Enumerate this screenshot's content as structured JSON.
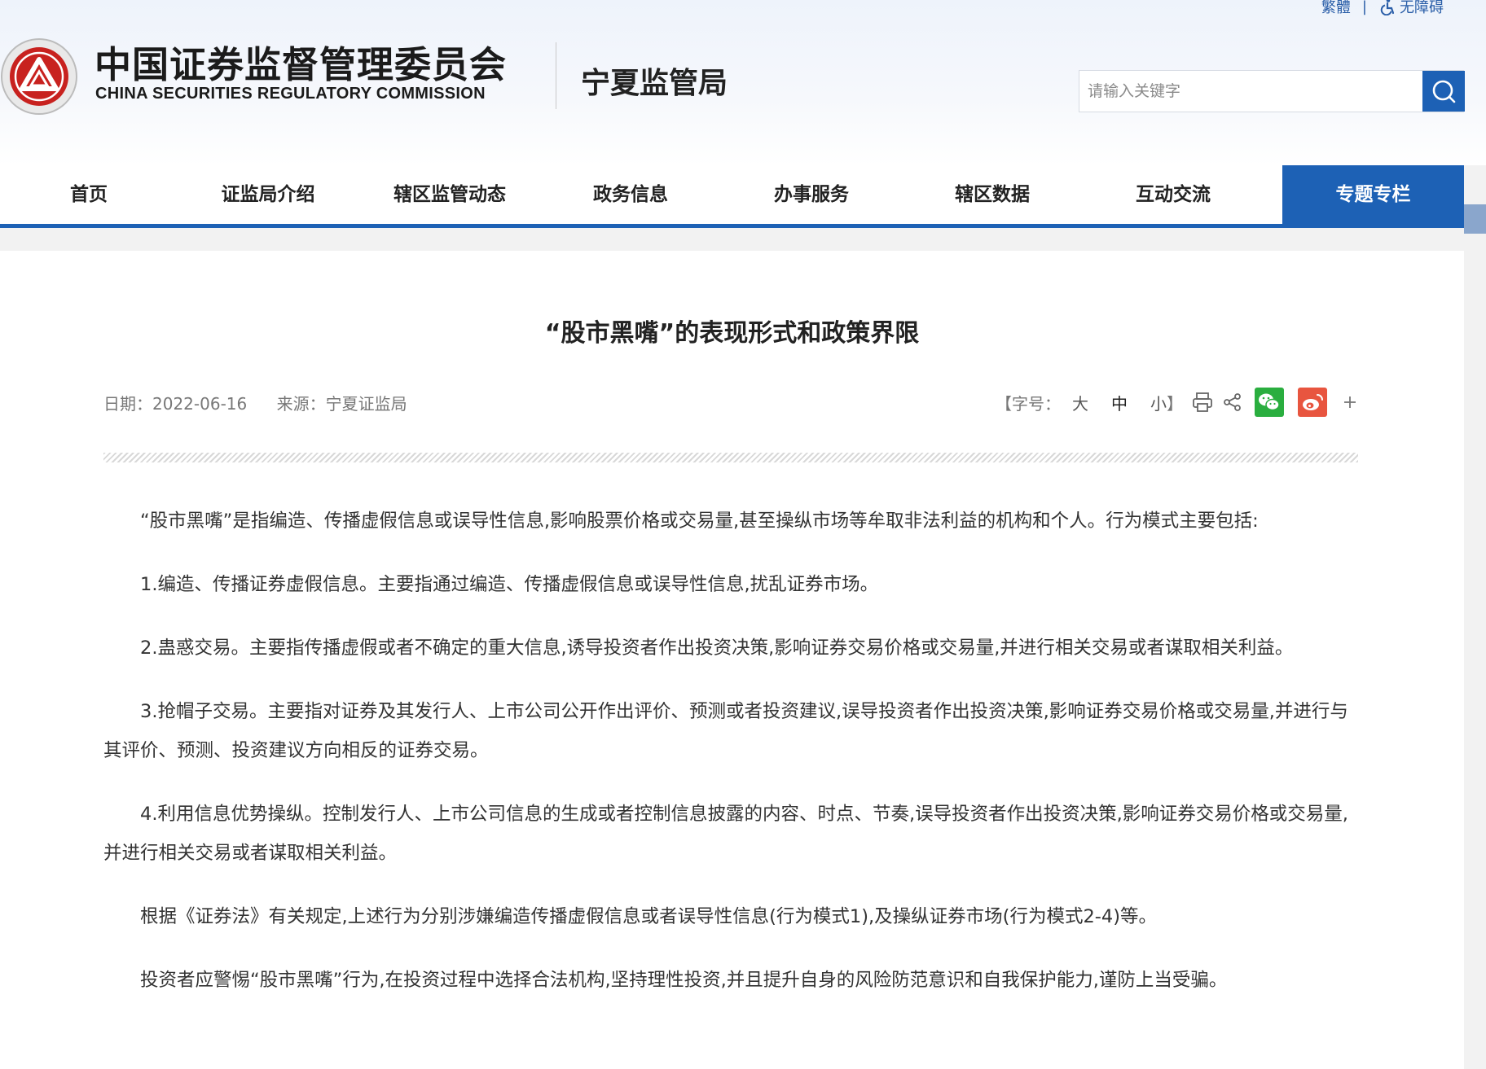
{
  "header": {
    "top_links": {
      "traditional": "繁體",
      "separator": "|",
      "accessibility": "无障碍"
    },
    "org_name_cn": "中国证券监督管理委员会",
    "org_name_en": "CHINA SECURITIES REGULATORY COMMISSION",
    "bureau_name": "宁夏监管局",
    "search": {
      "placeholder": "请输入关键字",
      "value": ""
    }
  },
  "nav": {
    "items": [
      {
        "label": "首页",
        "active": false
      },
      {
        "label": "证监局介绍",
        "active": false
      },
      {
        "label": "辖区监管动态",
        "active": false
      },
      {
        "label": "政务信息",
        "active": false
      },
      {
        "label": "办事服务",
        "active": false
      },
      {
        "label": "辖区数据",
        "active": false
      },
      {
        "label": "互动交流",
        "active": false
      },
      {
        "label": "专题专栏",
        "active": true
      }
    ]
  },
  "article": {
    "title": "“股市黑嘴”的表现形式和政策界限",
    "date": "日期：2022-06-16",
    "source": "来源：宁夏证监局",
    "font_size_label": "【字号：",
    "font_sizes": {
      "large": "大",
      "medium": "中",
      "small": "小"
    },
    "font_size_close": "】",
    "paragraphs": [
      "“股市黑嘴”是指编造、传播虚假信息或误导性信息,影响股票价格或交易量,甚至操纵市场等牟取非法利益的机构和个人。行为模式主要包括:",
      "1.编造、传播证券虚假信息。主要指通过编造、传播虚假信息或误导性信息,扰乱证券市场。",
      "2.蛊惑交易。主要指传播虚假或者不确定的重大信息,诱导投资者作出投资决策,影响证券交易价格或交易量,并进行相关交易或者谋取相关利益。",
      "3.抢帽子交易。主要指对证券及其发行人、上市公司公开作出评价、预测或者投资建议,误导投资者作出投资决策,影响证券交易价格或交易量,并进行与其评价、预测、投资建议方向相反的证券交易。",
      "4.利用信息优势操纵。控制发行人、上市公司信息的生成或者控制信息披露的内容、时点、节奏,误导投资者作出投资决策,影响证券交易价格或交易量,并进行相关交易或者谋取相关利益。",
      "根据《证券法》有关规定,上述行为分别涉嫌编造传播虚假信息或者误导性信息(行为模式1),及操纵证券市场(行为模式2-4)等。",
      "投资者应警惕“股市黑嘴”行为,在投资过程中选择合法机构,坚持理性投资,并且提升自身的风险防范意识和自我保护能力,谨防上当受骗。"
    ]
  },
  "colors": {
    "brand_blue": "#1d61b5",
    "wechat_green": "#2aae3f",
    "weibo_red": "#e8553f",
    "emblem_red": "#c8221f"
  },
  "icons": [
    "accessibility-icon",
    "search-icon",
    "print-icon",
    "share-icon",
    "wechat-icon",
    "weibo-icon",
    "plus-icon",
    "emblem-icon"
  ]
}
